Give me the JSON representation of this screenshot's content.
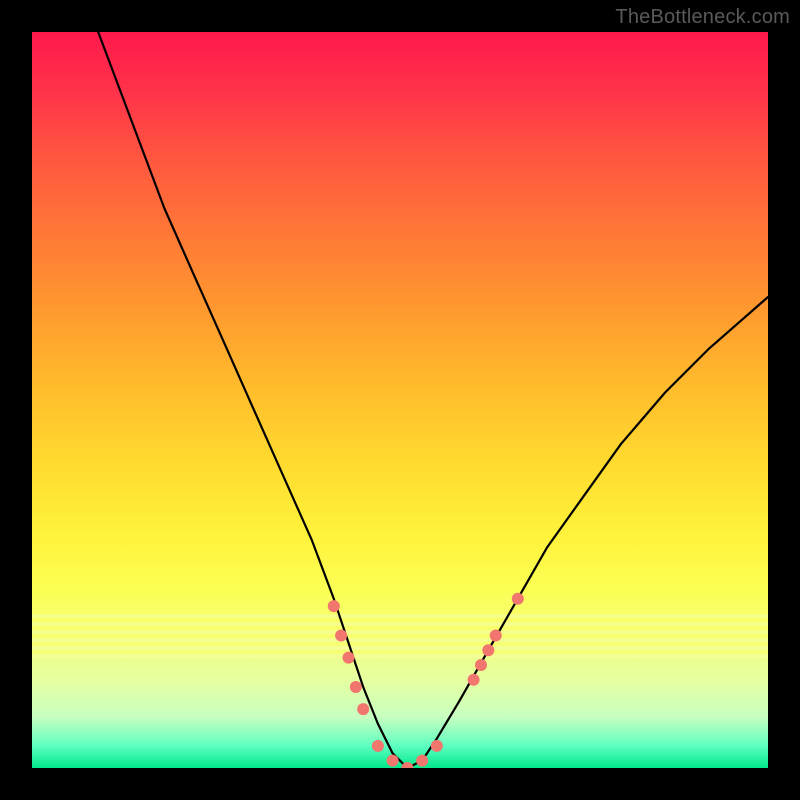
{
  "watermark": "TheBottleneck.com",
  "chart_data": {
    "type": "line",
    "title": "",
    "xlabel": "",
    "ylabel": "",
    "xlim": [
      0,
      100
    ],
    "ylim": [
      0,
      100
    ],
    "grid": false,
    "legend": false,
    "series": [
      {
        "name": "bottleneck-curve",
        "x": [
          9,
          12,
          15,
          18,
          22,
          26,
          30,
          34,
          38,
          41,
          43,
          45,
          47,
          49,
          51,
          53,
          55,
          58,
          62,
          66,
          70,
          75,
          80,
          86,
          92,
          100
        ],
        "y": [
          100,
          92,
          84,
          76,
          67,
          58,
          49,
          40,
          31,
          23,
          17,
          11,
          6,
          2,
          0,
          1,
          4,
          9,
          16,
          23,
          30,
          37,
          44,
          51,
          57,
          64
        ]
      }
    ],
    "markers": {
      "name": "highlight-dots",
      "color": "#f0766e",
      "points": [
        {
          "x": 41,
          "y": 22
        },
        {
          "x": 42,
          "y": 18
        },
        {
          "x": 43,
          "y": 15
        },
        {
          "x": 44,
          "y": 11
        },
        {
          "x": 45,
          "y": 8
        },
        {
          "x": 47,
          "y": 3
        },
        {
          "x": 49,
          "y": 1
        },
        {
          "x": 51,
          "y": 0
        },
        {
          "x": 53,
          "y": 1
        },
        {
          "x": 55,
          "y": 3
        },
        {
          "x": 60,
          "y": 12
        },
        {
          "x": 61,
          "y": 14
        },
        {
          "x": 62,
          "y": 16
        },
        {
          "x": 63,
          "y": 18
        },
        {
          "x": 66,
          "y": 23
        }
      ]
    },
    "background_gradient": {
      "top": "#ff1a4d",
      "mid": "#ffd92e",
      "bottom": "#00e889"
    }
  }
}
